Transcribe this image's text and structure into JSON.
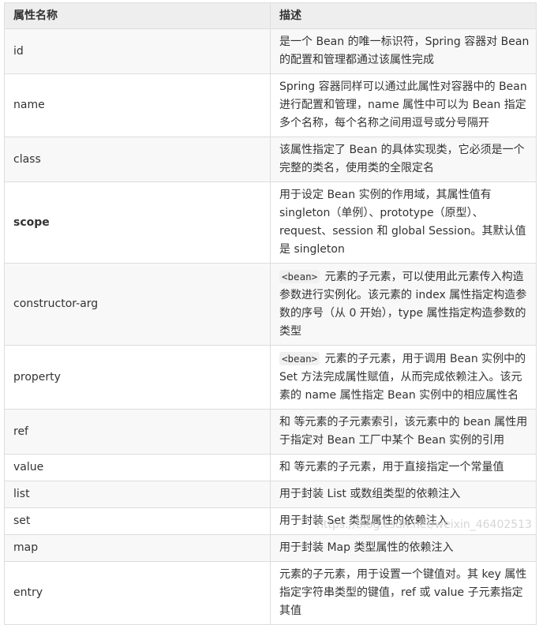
{
  "table": {
    "headers": {
      "name": "属性名称",
      "desc": "描述"
    },
    "rows": [
      {
        "name": "id",
        "desc": "是一个 Bean 的唯一标识符，Spring 容器对 Bean 的配置和管理都通过该属性完成"
      },
      {
        "name": "name",
        "desc": "Spring 容器同样可以通过此属性对容器中的 Bean 进行配置和管理，name 属性中可以为 Bean 指定多个名称，每个名称之间用逗号或分号隔开"
      },
      {
        "name": "class",
        "desc": "该属性指定了 Bean 的具体实现类，它必须是一个完整的类名，使用类的全限定名"
      },
      {
        "name": "scope",
        "desc": "用于设定 Bean 实例的作用域，其属性值有 singleton（单例）、prototype（原型）、request、session 和 global Session。其默认值是 singleton"
      },
      {
        "name": "constructor-arg",
        "code": "<bean>",
        "desc": " 元素的子元素，可以使用此元素传入构造参数进行实例化。该元素的 index 属性指定构造参数的序号（从 0 开始），type 属性指定构造参数的类型"
      },
      {
        "name": "property",
        "code": "<bean>",
        "desc": " 元素的子元素，用于调用 Bean 实例中的 Set 方法完成属性赋值，从而完成依赖注入。该元素的 name 属性指定 Bean 实例中的相应属性名"
      },
      {
        "name": "ref",
        "desc": "和 等元素的子元素索引，该元素中的 bean 属性用于指定对 Bean 工厂中某个 Bean 实例的引用"
      },
      {
        "name": "value",
        "desc": "和 等元素的子元素，用于直接指定一个常量值"
      },
      {
        "name": "list",
        "desc": "用于封装 List 或数组类型的依赖注入"
      },
      {
        "name": "set",
        "desc": "用于封装 Set 类型属性的依赖注入"
      },
      {
        "name": "map",
        "desc": "用于封装 Map 类型属性的依赖注入"
      },
      {
        "name": "entry",
        "desc": "元素的子元素，用于设置一个键值对。其 key 属性指定字符串类型的键值，ref 或 value 子元素指定其值"
      }
    ]
  },
  "watermark": "https://blog.csdn.net/weixin_46402513"
}
